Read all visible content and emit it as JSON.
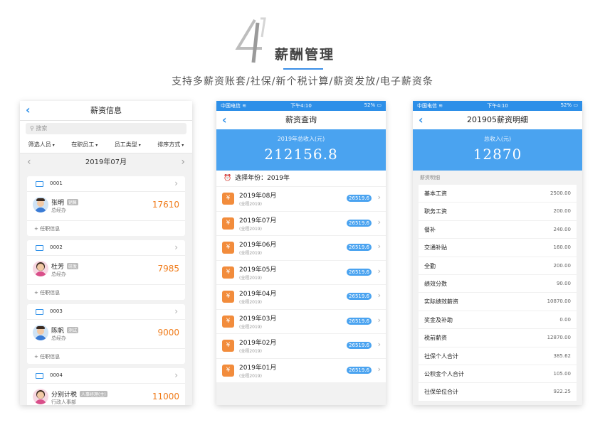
{
  "hero": {
    "number": "4",
    "title": "薪酬管理",
    "subtitle": "支持多薪资账套/社保/新个税计算/薪资发放/电子薪资条",
    "accent_color": "#3a8ee6"
  },
  "phone1": {
    "nav_title": "薪资信息",
    "back_icon": "chevron-left-icon",
    "search_placeholder": "搜索",
    "filters": [
      "筛选人员",
      "在职员工",
      "员工类型",
      "排序方式"
    ],
    "month": "2019年07月",
    "employees": [
      {
        "id": "0001",
        "name": "张明",
        "dept": "销售",
        "role": "总经办",
        "salary": "17610",
        "link": "+ 任职信息",
        "avatar": "male"
      },
      {
        "id": "0002",
        "name": "杜芳",
        "dept": "研发",
        "role": "总经办",
        "salary": "7985",
        "link": "+ 任职信息",
        "avatar": "female"
      },
      {
        "id": "0003",
        "name": "陈帆",
        "dept": "测试",
        "role": "总经办",
        "salary": "9000",
        "link": "+ 任职信息",
        "avatar": "male"
      },
      {
        "id": "0004",
        "name": "分别计税",
        "dept": "人事经理(主)",
        "role": "行政人事部",
        "salary": "11000",
        "link": "",
        "avatar": "female"
      }
    ],
    "salary_color": "#f07c1b"
  },
  "phone2": {
    "status": {
      "carrier": "中国电信",
      "time": "下午4:10",
      "battery": "52%"
    },
    "nav_title": "薪资查询",
    "total_label": "2019年总收入(元)",
    "total_value": "212156.8",
    "year_label": "选择年份：2019年",
    "items": [
      {
        "month": "2019年08月",
        "sub": "(全程2019)",
        "amount": "26519.6"
      },
      {
        "month": "2019年07月",
        "sub": "(全程2019)",
        "amount": "26519.6"
      },
      {
        "month": "2019年06月",
        "sub": "(全程2019)",
        "amount": "26519.6"
      },
      {
        "month": "2019年05月",
        "sub": "(全程2019)",
        "amount": "26519.6"
      },
      {
        "month": "2019年04月",
        "sub": "(全程2019)",
        "amount": "26519.6"
      },
      {
        "month": "2019年03月",
        "sub": "(全程2019)",
        "amount": "26519.6"
      },
      {
        "month": "2019年02月",
        "sub": "(全程2019)",
        "amount": "26519.6"
      },
      {
        "month": "2019年01月",
        "sub": "(全程2019)",
        "amount": "26519.6"
      }
    ],
    "primary_color": "#4aa3f0",
    "icon_color": "#f28c3c"
  },
  "phone3": {
    "status": {
      "carrier": "中国电信",
      "time": "下午4:10",
      "battery": "52%"
    },
    "nav_title": "201905薪资明细",
    "total_label": "总收入(元)",
    "total_value": "12870",
    "section_label": "薪资明细",
    "rows": [
      {
        "label": "基本工资",
        "value": "2500.00"
      },
      {
        "label": "职务工资",
        "value": "200.00"
      },
      {
        "label": "餐补",
        "value": "240.00"
      },
      {
        "label": "交通补贴",
        "value": "160.00"
      },
      {
        "label": "全勤",
        "value": "200.00"
      },
      {
        "label": "绩效分数",
        "value": "90.00"
      },
      {
        "label": "实际绩效薪资",
        "value": "10870.00"
      },
      {
        "label": "奖金及补助",
        "value": "0.00"
      },
      {
        "label": "税前薪资",
        "value": "12870.00"
      },
      {
        "label": "社保个人合计",
        "value": "385.62"
      },
      {
        "label": "公积金个人合计",
        "value": "105.00"
      },
      {
        "label": "社保单位合计",
        "value": "922.25"
      }
    ]
  }
}
